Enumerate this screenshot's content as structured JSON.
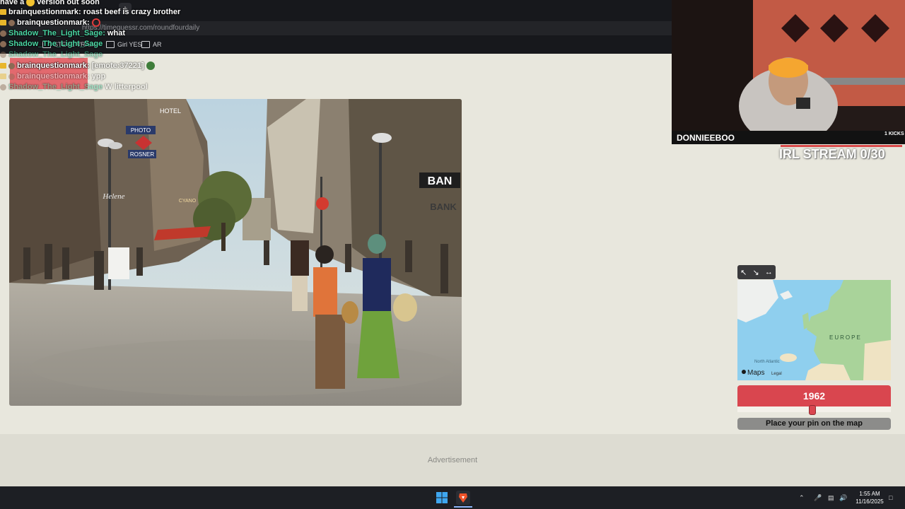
{
  "browser": {
    "url": "https://timeguessr.com/roundfourdaily",
    "bookmarks": [
      "STEVE VRAIN",
      "Girl YES",
      "AR"
    ],
    "new_tab": "+"
  },
  "chat": [
    {
      "user": "",
      "text": "have a",
      "text2": "version out soon"
    },
    {
      "user": "brainquestionmark:",
      "text": "roast beef is crazy brother"
    },
    {
      "user": "brainquestionmark:",
      "text": ""
    },
    {
      "user": "Shadow_The_Light_Sage:",
      "text": "what"
    },
    {
      "user": "Shadow_The_Light_Sage",
      "text": ""
    },
    {
      "user": "Shadow_The_Light_Sage",
      "text": ""
    },
    {
      "user": "brainquestionmark:",
      "text": "[emote:37221]"
    },
    {
      "user": "brainquestionmark:",
      "text": "ypp"
    },
    {
      "user": "Shadow_The_Light_Sage",
      "text": "W litterpool"
    }
  ],
  "photo": {
    "signs": [
      "HOTEL",
      "PHOTO",
      "ROSNER",
      "BAN",
      "BANK",
      "CYANO",
      "Helene"
    ]
  },
  "stream": {
    "streamer": "DONNIEEBOO",
    "kicks": "1 KICKS",
    "goal": "IRL STREAM 0/30"
  },
  "map": {
    "controls": [
      "↖",
      "↘",
      "↔"
    ],
    "label_europe": "EUROPE",
    "label_atlantic": "North Atlantic",
    "provider": "Maps",
    "legal": "Legal"
  },
  "guess": {
    "year": "1962",
    "year_fraction": 0.49,
    "pin_button": "Place your pin on the map"
  },
  "ad": {
    "label": "Advertisement"
  },
  "taskbar": {
    "time": "1:55 AM",
    "date": "11/16/2025"
  },
  "colors": {
    "accent": "#d9464f",
    "chat_green": "#4ad6a3",
    "page_bg": "#e8e7dd"
  }
}
